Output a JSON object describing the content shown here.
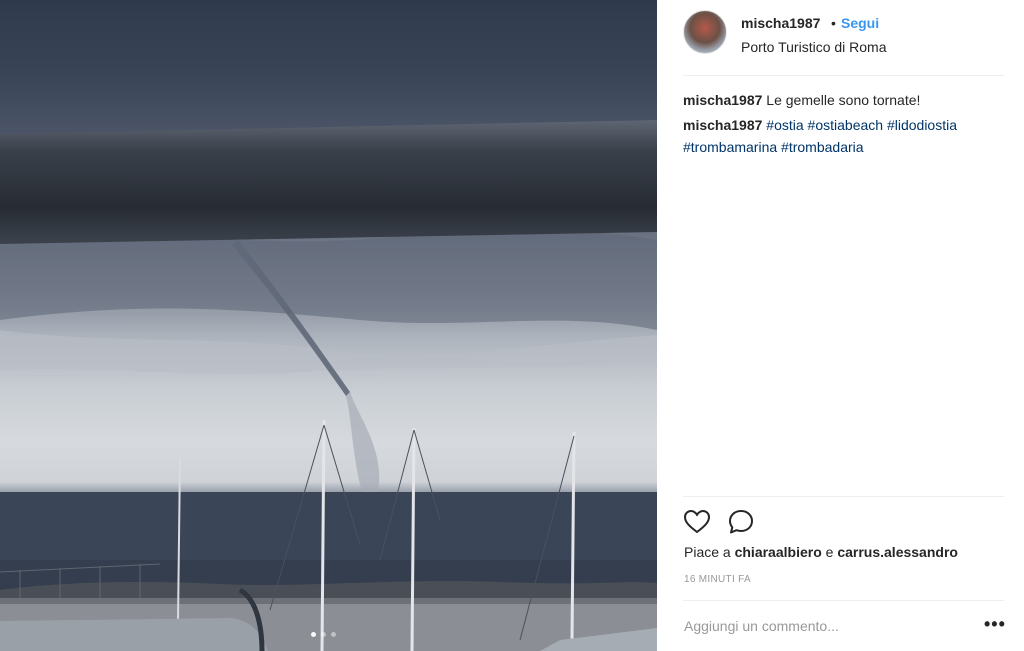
{
  "post": {
    "author": "mischa1987",
    "separator": "•",
    "follow_label": "Segui",
    "location": "Porto Turistico di Roma",
    "caption": {
      "user": "mischa1987",
      "text": "Le gemelle sono tornate!"
    },
    "hashtag_comment": {
      "user": "mischa1987",
      "tags": [
        "#ostia",
        "#ostiabeach",
        "#lidodiostia",
        "#trombamarina",
        "#trombadaria"
      ]
    },
    "likes": {
      "prefix": "Piace a",
      "user1": "chiaraalbiero",
      "conjunction": "e",
      "user2": "carrus.alessandro"
    },
    "timestamp": "16 MINUTI FA",
    "comment_placeholder": "Aggiungi un commento...",
    "more_label": "•••",
    "carousel": {
      "count": 3,
      "active_index": 0
    }
  },
  "icons": {
    "like": "heart-icon",
    "comment": "comment-bubble-icon",
    "more": "more-options-icon"
  },
  "colors": {
    "link": "#3897f0",
    "hashtag": "#003569",
    "text": "#262626",
    "muted": "#999999"
  }
}
